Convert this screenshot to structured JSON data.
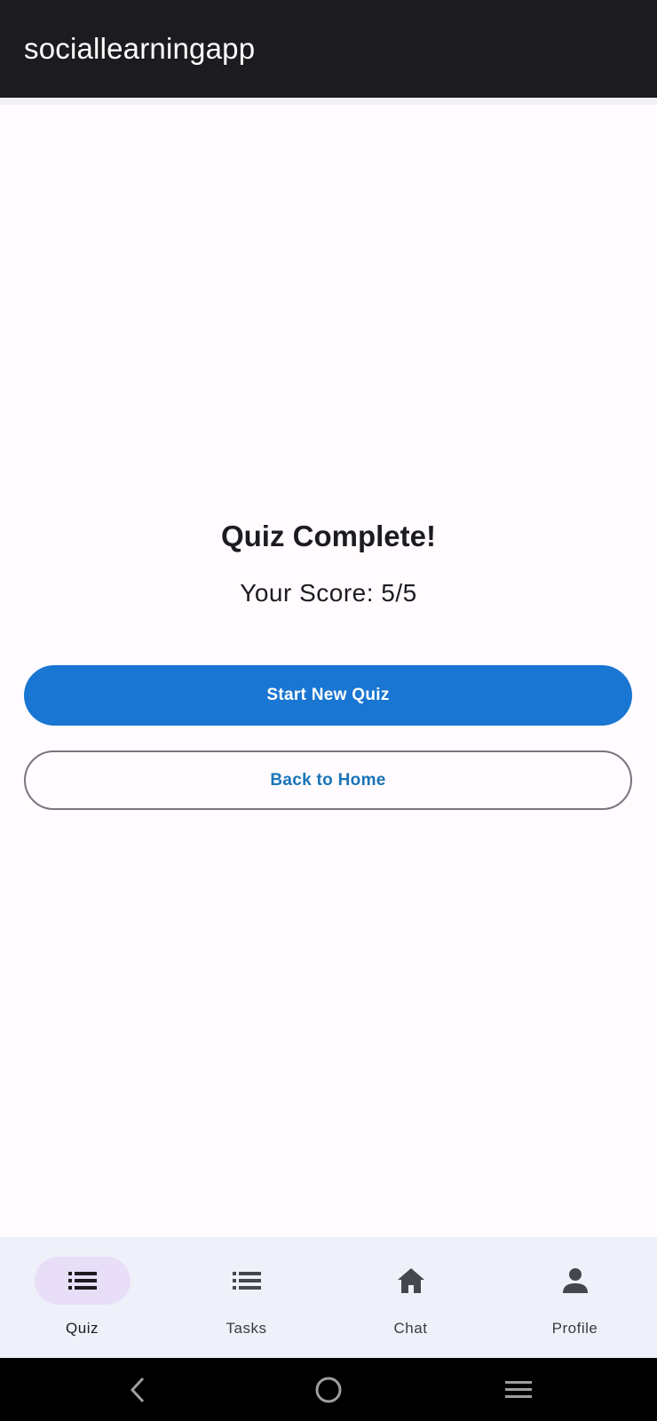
{
  "app_bar": {
    "title": "sociallearningapp"
  },
  "result": {
    "title": "Quiz Complete!",
    "score": "Your Score: 5/5"
  },
  "actions": {
    "start_new_quiz_label": "Start New Quiz",
    "back_to_home_label": "Back to Home"
  },
  "bottom_nav": {
    "items": [
      {
        "label": "Quiz",
        "icon": "list-icon",
        "active": true
      },
      {
        "label": "Tasks",
        "icon": "list-icon",
        "active": false
      },
      {
        "label": "Chat",
        "icon": "home-icon",
        "active": false
      },
      {
        "label": "Profile",
        "icon": "person-icon",
        "active": false
      }
    ]
  },
  "system_nav": {
    "buttons": [
      "back-icon",
      "home-circle-icon",
      "recents-icon"
    ]
  },
  "colors": {
    "app_bar_bg": "#1c1b1f",
    "primary": "#1976d2",
    "outline": "#79747e",
    "outline_text": "#1a74b8",
    "nav_bg": "#eef1f9",
    "nav_active_indicator": "#e8def8",
    "background": "#fffbfe"
  }
}
